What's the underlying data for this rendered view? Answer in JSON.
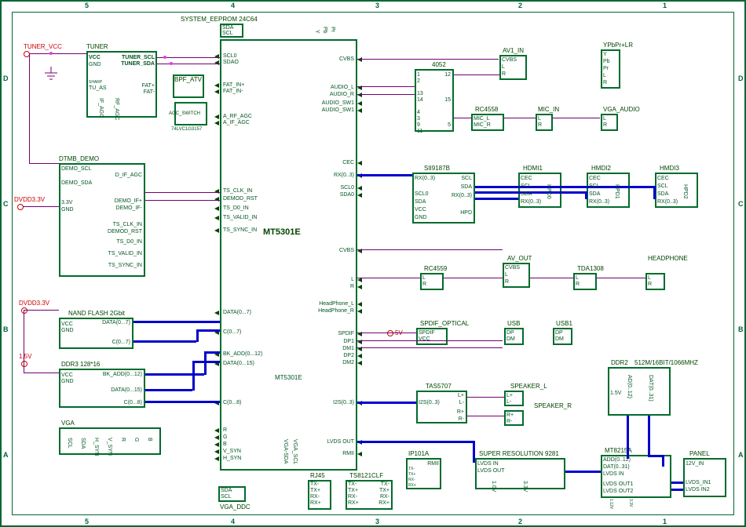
{
  "grid": {
    "cols": [
      "5",
      "4",
      "3",
      "2",
      "1"
    ],
    "rows": [
      "D",
      "C",
      "B",
      "A"
    ]
  },
  "power": {
    "tuner_vcc": "TUNER_VCC",
    "dvdd33a": "DVDD3.3V",
    "dvdd33b": "DVDD3.3V",
    "v15": "1.5V",
    "v5": "5V"
  },
  "main": {
    "name": "MT5301E",
    "title": "MT5301E",
    "left_pins": [
      "SCL0",
      "SDAO",
      "",
      "FAT_IN+",
      "FAT_IN-",
      "",
      "A_RF_AGC",
      "A_IF_AGC",
      "",
      "",
      "TS_CLK_IN",
      "DEMOD_RST",
      "TS_D0_IN",
      "TS_VALID_IN",
      "TS_SYNC_IN",
      "",
      "DATA(0...7)",
      "C(0...7)",
      "",
      "BK_ADD(0...12)",
      "DATA(0...15)",
      "",
      "C(0...8)",
      "",
      "R",
      "G",
      "B",
      "V_SYN",
      "H_SYN"
    ],
    "right_pins": [
      "CVBS",
      "",
      "AUDIO_L",
      "AUDIO_R",
      "AUDIO_SW1",
      "AUDIO_SW1",
      "",
      "CEC",
      "RX(0..3)",
      "SCL0",
      "SDA0",
      "",
      "CVBS",
      "L",
      "R",
      "HeadPhone_L",
      "HeadPhone_R",
      "",
      "SPDIF",
      "DP1",
      "DM1",
      "DP2",
      "DM2",
      "",
      "I2S(0..3)",
      "",
      "LVDS OUT",
      "RMII"
    ],
    "top_pins": [
      "Y",
      "Pb",
      "Pr"
    ],
    "right_side": [
      "VGA-SDA",
      "VGA_SCL"
    ]
  },
  "blocks": {
    "eeprom": {
      "title": "SYSTEM_EEPROM 24C64",
      "pins": [
        "SDA",
        "SCL"
      ]
    },
    "tuner": {
      "title": "TUNER",
      "left": [
        "VCC",
        "GND",
        "SHARP",
        "TU_AS"
      ],
      "right": [
        "TUNER_SCL",
        "TUNER_SDA",
        "",
        "FAT+",
        "FAT-"
      ],
      "inner": [
        "IF_AGC",
        "RF_AGC"
      ]
    },
    "bpf": {
      "title": "BPF_ATV"
    },
    "agc": {
      "title": "AGC_SWITCH",
      "sub": "74LVC1G3157"
    },
    "dtmb": {
      "title": "DTMB_DEMO",
      "left": [
        "DEMO_SCL",
        "DEMO_SDA",
        "",
        "3.3V",
        "GND"
      ],
      "right": [
        "D_IF_AGC",
        "",
        "DEMO_IF+",
        "DEMO_IF-",
        "",
        "TS_CLK_IN",
        "DEMOD_RST",
        "TS_D0_IN",
        "TS_VALID_IN",
        "TS_SYNC_IN"
      ]
    },
    "nand": {
      "title": "NAND FLASH 2Gbit",
      "left": [
        "VCC",
        "GND"
      ],
      "right": [
        "DATA(0...7)",
        "",
        "C(0...7)"
      ]
    },
    "ddr3": {
      "title": "DDR3 128*16",
      "left": [
        "VCC",
        "GND"
      ],
      "right": [
        "BK_ADD(0...12)",
        "DATA(0...15)",
        "C(0...8)"
      ]
    },
    "vga": {
      "title": "VGA",
      "pins": [
        "SCL",
        "SDA",
        "H_SYN",
        "V_SYN",
        "R",
        "G",
        "B"
      ]
    },
    "vga_ddc": {
      "title": "VGA_DDC",
      "pins": [
        "SDA",
        "SCL"
      ]
    },
    "rj45": {
      "title": "RJ45",
      "pins": [
        "TX-",
        "TX+",
        "RX-",
        "RX+"
      ]
    },
    "ts8121": {
      "title": "TS8121CLF",
      "left": [
        "TX-",
        "TX+",
        "RX-",
        "RX+"
      ],
      "right": [
        "TX-",
        "TX+",
        "RX-",
        "RX+"
      ]
    },
    "ip101": {
      "title": "IP101A",
      "left": [
        "TX-",
        "TX+",
        "RX-",
        "RX+"
      ],
      "right": [
        "RMII"
      ]
    },
    "mux4052": {
      "title": "4052",
      "left": [
        "1",
        "2",
        "",
        "13",
        "14",
        "",
        "4",
        "3",
        "9",
        "11"
      ],
      "right": [
        "12",
        "",
        "15",
        "",
        "5"
      ]
    },
    "av1": {
      "title": "AV1_IN",
      "pins": [
        "CVBS",
        "L",
        "R"
      ]
    },
    "ypbpr": {
      "title": "YPbPr+LR",
      "pins": [
        "Y",
        "Pb",
        "Pr",
        "L",
        "R"
      ]
    },
    "rc4558": {
      "title": "RC4558",
      "pins": [
        "MIC_L",
        "MIC_R"
      ]
    },
    "mic": {
      "title": "MIC_IN",
      "pins": [
        "L",
        "R"
      ]
    },
    "vga_audio": {
      "title": "VGA_AUDIO",
      "pins": [
        "L",
        "R"
      ]
    },
    "sii": {
      "title": "SII9187B",
      "left": [
        "RX(0..3)",
        "",
        "SCL0",
        "SDA",
        "VCC",
        "GND"
      ],
      "right": [
        "SCL",
        "SDA",
        "RX(0..3)",
        "",
        "HPD"
      ]
    },
    "hdmi1": {
      "title": "HDMI1",
      "pins": [
        "CEC",
        "SCL",
        "SDA",
        "RX(0..3)"
      ],
      "side": "HPD0"
    },
    "hdmi2": {
      "title": "HMDI2",
      "pins": [
        "CEC",
        "SCL",
        "SDA",
        "RX(0..3)"
      ],
      "side": "HPD1"
    },
    "hdmi3": {
      "title": "HMDI3",
      "pins": [
        "CEC",
        "SCL",
        "SDA",
        "RX(0..3)"
      ],
      "side": "HPD2"
    },
    "rc4559": {
      "title": "RC4559",
      "pins": [
        "L",
        "R"
      ]
    },
    "avout": {
      "title": "AV_OUT",
      "pins": [
        "CVBS",
        "L",
        "R"
      ]
    },
    "tda": {
      "title": "TDA1308",
      "pins": [
        "L",
        "R"
      ]
    },
    "hp": {
      "title": "HEADPHONE",
      "pins": [
        "L",
        "R"
      ]
    },
    "spdif": {
      "title": "SPDIF_OPTICAL",
      "pins": [
        "SPDIF",
        "VCC"
      ]
    },
    "usb": {
      "title": "USB",
      "pins": [
        "DP",
        "DM"
      ]
    },
    "usb1": {
      "title": "USB1",
      "pins": [
        "DP",
        "DM"
      ]
    },
    "tas": {
      "title": "TAS5707",
      "left": [
        "I2S(0..3)"
      ],
      "right": [
        "L+",
        "L-",
        "R+",
        "R-"
      ]
    },
    "spkL": {
      "title": "SPEAKER_L",
      "pins": [
        "L+",
        "L-"
      ]
    },
    "spkR": {
      "title": "SPEAKER_R",
      "pins": [
        "R+",
        "R-"
      ]
    },
    "super": {
      "title": "SUPER RESOLUTION 9281",
      "left": [
        "LVDS IN",
        "LVDS OUT"
      ],
      "bottom": [
        "1.0V",
        "3.3V"
      ]
    },
    "ddr2": {
      "title": "DDR2",
      "sub": "512M/16BIT/1066MHZ",
      "left": [
        "1.5V"
      ],
      "inner": [
        "AD(0..12)",
        "DAT(0..31)"
      ]
    },
    "mt8215": {
      "title": "MT8215A",
      "left": [
        "ADD(0..12)",
        "DAT(0..31)",
        "LVDS IN",
        "LVDS OUT1",
        "LVDS OUT2"
      ],
      "bottom": [
        "1.12V",
        "3.3V"
      ]
    },
    "panel": {
      "title": "PANEL",
      "pins": [
        "12V_IN",
        "",
        "LVDS_IN1",
        "LVDS IN2"
      ]
    }
  }
}
